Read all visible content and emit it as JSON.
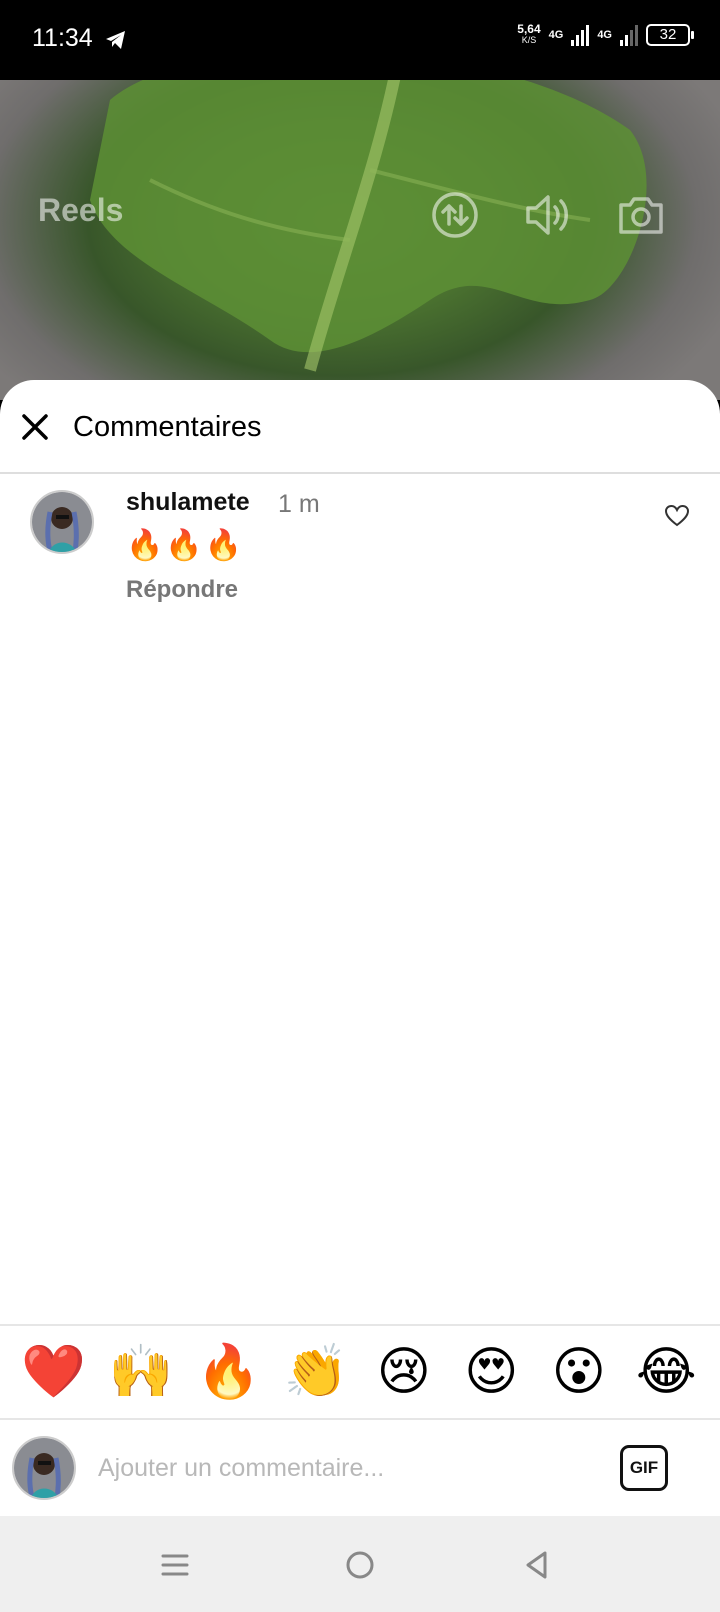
{
  "status_bar": {
    "time": "11:34",
    "speed_value": "5,64",
    "speed_unit": "K/S",
    "network_1": "4G",
    "network_2": "4G",
    "battery": "32"
  },
  "video": {
    "title": "Reels",
    "icons": [
      "switch-icon",
      "speaker-icon",
      "camera-icon"
    ]
  },
  "sheet": {
    "title": "Commentaires"
  },
  "comments": [
    {
      "username": "shulamete",
      "time": "1 m",
      "text": "🔥🔥🔥",
      "reply_label": "Répondre"
    }
  ],
  "emoji_bar": [
    "❤️",
    "🙌",
    "🔥",
    "👏",
    "😢",
    "😍",
    "😮",
    "😂"
  ],
  "composer": {
    "placeholder": "Ajouter un commentaire...",
    "gif_label": "GIF"
  },
  "colors": {
    "accent_text": "#000000",
    "secondary_text": "#777777",
    "divider": "#dedede"
  }
}
